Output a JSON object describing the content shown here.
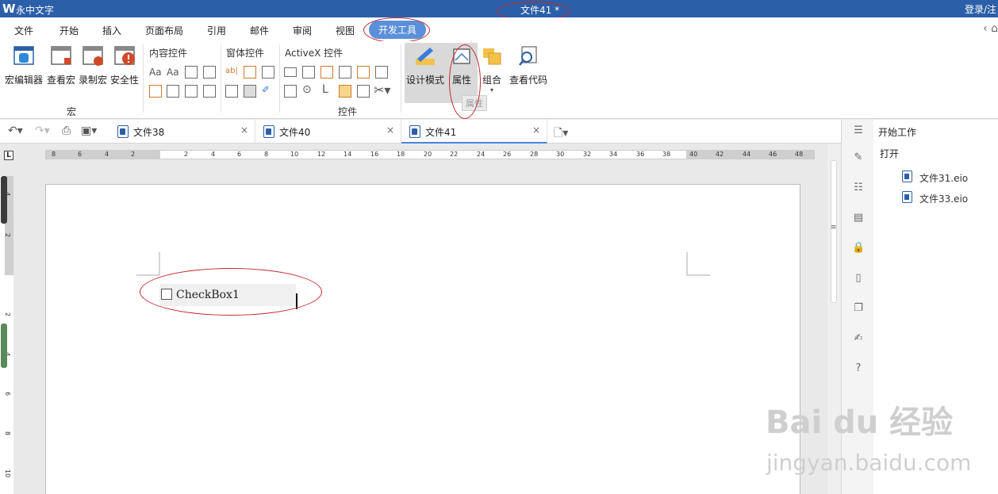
{
  "window": {
    "app_name": "永中文字",
    "document_title": "文件41 *",
    "login": "登录/注"
  },
  "menu": {
    "items": [
      "文件",
      "开始",
      "插入",
      "页面布局",
      "引用",
      "邮件",
      "审阅",
      "视图",
      "开发工具"
    ],
    "active": "开发工具"
  },
  "ribbon": {
    "macro_group": {
      "label": "宏",
      "buttons": [
        "宏编辑器",
        "查看宏",
        "录制宏",
        "安全性"
      ]
    },
    "controls_group": {
      "label": "控件",
      "content_controls": "内容控件",
      "form_controls": "窗体控件",
      "activex_controls": "ActiveX 控件"
    },
    "buttons": {
      "design_mode": "设计模式",
      "properties": "属性",
      "group": "组合",
      "view_code": "查看代码"
    },
    "tooltip": "属性",
    "text_glyph_1": "Aa",
    "text_glyph_2": "Aa",
    "text_glyph_ab": "ab|"
  },
  "tabs": [
    {
      "label": "文件38",
      "close": "×"
    },
    {
      "label": "文件40",
      "close": "×"
    },
    {
      "label": "文件41",
      "close": "×"
    }
  ],
  "ruler": {
    "corner": "L",
    "h_ticks": [
      "8",
      "6",
      "4",
      "2",
      "2",
      "4",
      "6",
      "8",
      "10",
      "12",
      "14",
      "16",
      "18",
      "20",
      "22",
      "24",
      "26",
      "28",
      "30",
      "32",
      "34",
      "36",
      "38",
      "40",
      "42",
      "44",
      "46",
      "48"
    ],
    "v_ticks": [
      "4",
      "2",
      "2",
      "4",
      "6",
      "8",
      "10"
    ]
  },
  "document": {
    "checkbox_label": "CheckBox1"
  },
  "sidepanel": {
    "title": "开始工作",
    "open_label": "打开",
    "files": [
      "文件31.eio",
      "文件33.eio"
    ]
  },
  "watermark": {
    "logo": "Bai du 经验",
    "url": "jingyan.baidu.com"
  }
}
